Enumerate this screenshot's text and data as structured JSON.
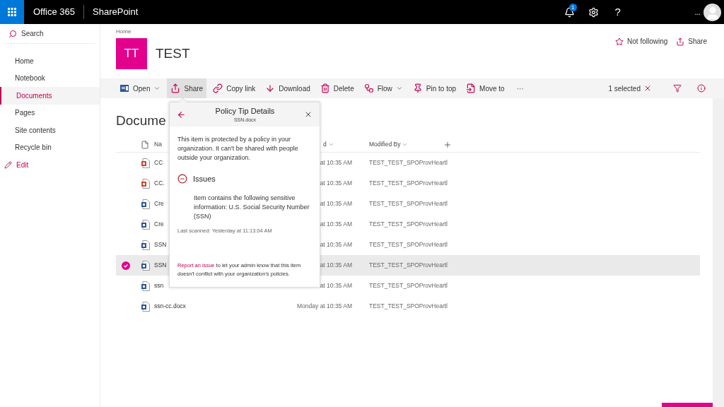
{
  "topbar": {
    "brand": "Office 365",
    "app": "SharePoint",
    "notification_count": "1",
    "help": "?",
    "more": "..."
  },
  "sidebar": {
    "search": {
      "placeholder": "Search"
    },
    "items": [
      {
        "label": "Home",
        "selected": false
      },
      {
        "label": "Notebook",
        "selected": false
      },
      {
        "label": "Documents",
        "selected": true
      },
      {
        "label": "Pages",
        "selected": false
      },
      {
        "label": "Site contents",
        "selected": false
      },
      {
        "label": "Recycle bin",
        "selected": false
      }
    ],
    "edit": "Edit"
  },
  "site": {
    "breadcrumb": "Home",
    "logo": "TT",
    "title": "TEST",
    "actions": [
      {
        "label": "Not following",
        "kind": "follow"
      },
      {
        "label": "Share",
        "kind": "share"
      }
    ]
  },
  "toolbar": {
    "commands": [
      {
        "label": "Open",
        "kind": "open",
        "dropdown": true,
        "selected": false
      },
      {
        "label": "Share",
        "kind": "share",
        "dropdown": false,
        "selected": true
      },
      {
        "label": "Copy link",
        "kind": "link",
        "dropdown": false,
        "selected": false
      },
      {
        "label": "Download",
        "kind": "download",
        "dropdown": false,
        "selected": false
      },
      {
        "label": "Delete",
        "kind": "delete",
        "dropdown": false,
        "selected": false
      },
      {
        "label": "Flow",
        "kind": "flow",
        "dropdown": true,
        "selected": false
      },
      {
        "label": "Pin to top",
        "kind": "pin",
        "dropdown": false,
        "selected": false
      },
      {
        "label": "Move to",
        "kind": "move",
        "dropdown": false,
        "selected": false
      }
    ],
    "more": "···",
    "selection": "1 selected"
  },
  "library": {
    "title": "Docume",
    "columns": [
      {
        "label": "Na",
        "kind": "name"
      },
      {
        "label": "d",
        "kind": "modified"
      },
      {
        "label": "Modified By",
        "kind": "modified_by"
      }
    ],
    "rows": [
      {
        "name": "CC",
        "kind": "pptx",
        "modified": "at 10:35 AM",
        "modified_by": "TEST_TEST_SPOProvHeartl",
        "selected": false
      },
      {
        "name": "CC.",
        "kind": "pptx",
        "modified": "at 10:35 AM",
        "modified_by": "TEST_TEST_SPOProvHeartl",
        "selected": false
      },
      {
        "name": "Cre",
        "kind": "docx",
        "modified": "at 10:35 AM",
        "modified_by": "TEST_TEST_SPOProvHeartl",
        "selected": false
      },
      {
        "name": "Cre",
        "kind": "docx",
        "modified": "at 10:35 AM",
        "modified_by": "TEST_TEST_SPOProvHeartl",
        "selected": false
      },
      {
        "name": "SSN",
        "kind": "docx",
        "modified": "at 10:35 AM",
        "modified_by": "TEST_TEST_SPOProvHeartl",
        "selected": false
      },
      {
        "name": "SSN",
        "kind": "docx",
        "modified": "at 10:35 AM",
        "modified_by": "TEST_TEST_SPOProvHeartl",
        "selected": true
      },
      {
        "name": "ssn",
        "kind": "docx",
        "modified": "at 10:35 AM",
        "modified_by": "TEST_TEST_SPOProvHeartl",
        "selected": false
      },
      {
        "name": "ssn-cc.docx",
        "kind": "docx",
        "modified": "Monday at 10:35 AM",
        "modified_by": "TEST_TEST_SPOProvHeartl",
        "selected": false
      }
    ]
  },
  "popup": {
    "title": "Policy Tip Details",
    "subtitle": "SSN.docx",
    "message": "This item is protected by a policy in your organization. It can't be shared with people outside your organization.",
    "issues_heading": "Issues",
    "issue": "Item contains the following sensitive information: U.S. Social Security Number (SSN)",
    "last_scanned": "Last scanned: Yesterday at 11:13:04 AM",
    "report_link": "Report an issue",
    "report_text": " to let your admin know that this item doesn't conflict with your organization's policies."
  }
}
